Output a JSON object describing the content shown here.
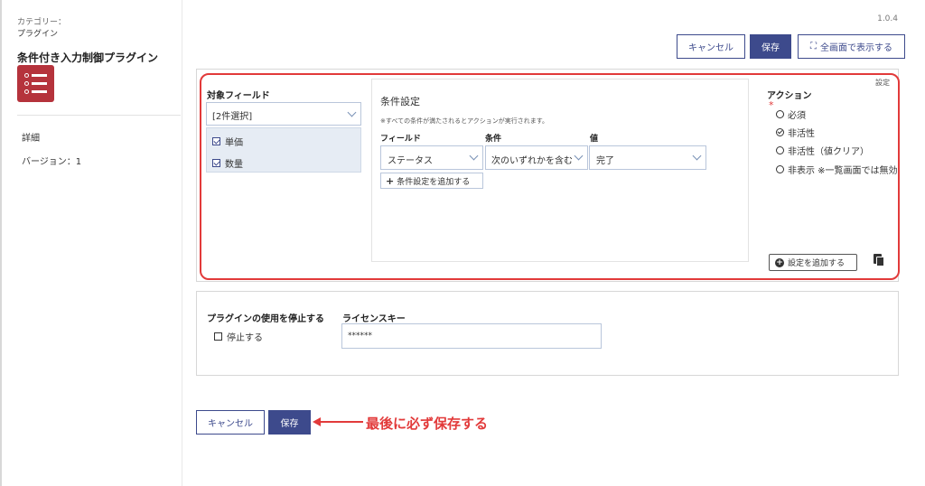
{
  "version": "1.0.4",
  "sidebar": {
    "category_label": "カテゴリー：",
    "category_value": "プラグイン",
    "plugin_title": "条件付き入力制御プラグイン",
    "detail": "詳細",
    "version_label": "バージョン：1"
  },
  "toolbar": {
    "cancel": "キャンセル",
    "save": "保存",
    "fullscreen": "全画面で表示する"
  },
  "settings": {
    "settei_link": "設定",
    "target": {
      "title": "対象フィールド",
      "select_value": "[2件選択]",
      "items": [
        "単価",
        "数量"
      ]
    },
    "conditions": {
      "title": "条件設定",
      "note": "※すべての条件が満たされるとアクションが実行されます。",
      "col_field": "フィールド",
      "col_condition": "条件",
      "col_value": "値",
      "field_value": "ステータス",
      "condition_value": "次のいずれかを含む",
      "value_value": "完了",
      "add_condition": "条件設定を追加する"
    },
    "actions": {
      "title": "アクション",
      "options": [
        "必須",
        "非活性",
        "非活性（値クリア）",
        "非表示 ※一覧画面では無効"
      ],
      "selected_index": 1
    },
    "add_setting": "設定を追加する"
  },
  "license": {
    "stop_title": "プラグインの使用を停止する",
    "stop_checkbox": "停止する",
    "license_title": "ライセンスキー",
    "license_value": "******"
  },
  "bottom": {
    "cancel": "キャンセル",
    "save": "保存",
    "note": "最後に必ず保存する"
  },
  "colors": {
    "primary": "#3d4a8c",
    "highlight_red": "#e23a3a",
    "plugin_icon": "#b5333c"
  }
}
